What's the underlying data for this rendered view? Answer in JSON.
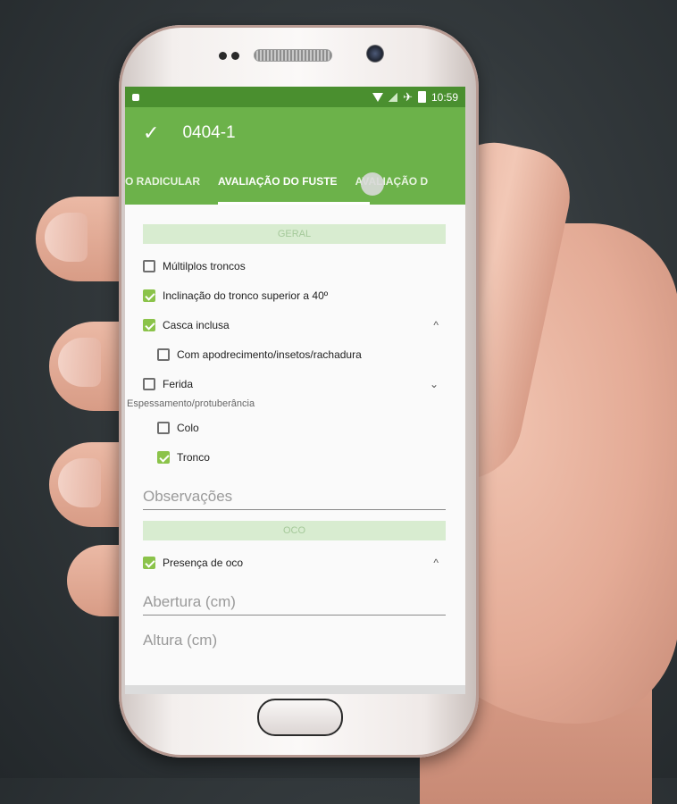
{
  "status_bar": {
    "time": "10:59"
  },
  "app_bar": {
    "check_icon": "✓",
    "title": "0404-1"
  },
  "tabs": [
    {
      "label": "O RADICULAR"
    },
    {
      "label": "AVALIAÇÃO DO FUSTE"
    },
    {
      "label": "AVALIAÇÃO D"
    }
  ],
  "geral": {
    "header": "GERAL",
    "items": [
      {
        "label": "Múltilplos troncos",
        "checked": false
      },
      {
        "label": "Inclinação do tronco superior a 40º",
        "checked": true
      },
      {
        "label": "Casca inclusa",
        "checked": true,
        "chevron": "^"
      },
      {
        "label": "Com apodrecimento/insetos/rachadura",
        "checked": false
      },
      {
        "label": "Ferida",
        "checked": false,
        "chevron": "⌄"
      }
    ],
    "group_label": "Espessamento/protuberância",
    "sub_items": [
      {
        "label": "Colo",
        "checked": false
      },
      {
        "label": "Tronco",
        "checked": true
      }
    ],
    "observacoes_placeholder": "Observações"
  },
  "oco": {
    "header": "OCO",
    "item": {
      "label": "Presença de oco",
      "checked": true,
      "chevron": "^"
    },
    "abertura_placeholder": "Abertura (cm)",
    "altura_placeholder": "Altura (cm)"
  },
  "colors": {
    "primary": "#6cb24a",
    "primary_dark": "#4a8f2f",
    "accent": "#8bc34a"
  }
}
